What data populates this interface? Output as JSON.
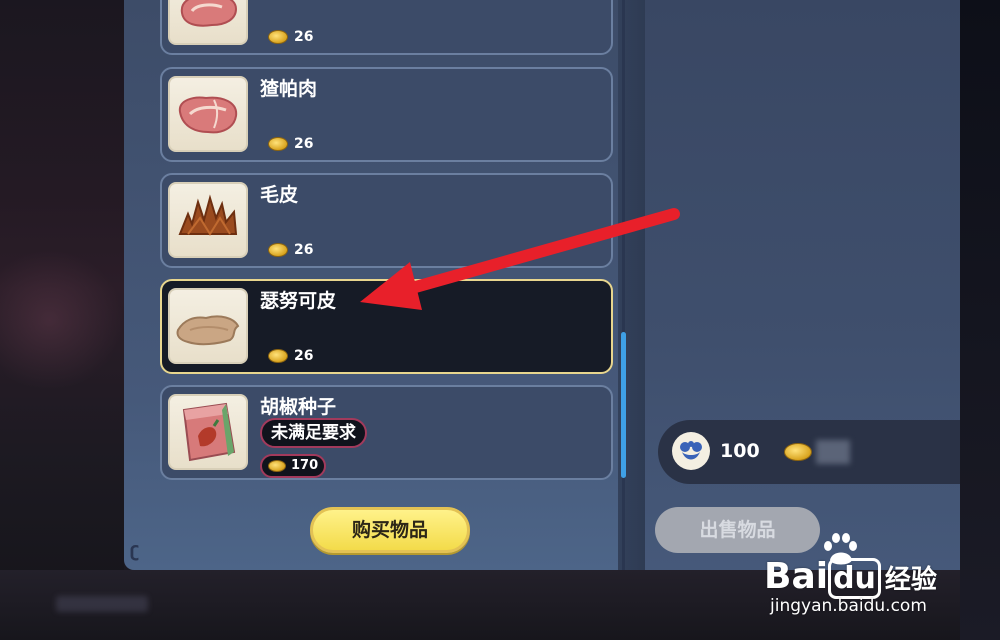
{
  "items": [
    {
      "name": "",
      "price": "26",
      "icon": "raw-meat-icon"
    },
    {
      "name": "猹帕肉",
      "price": "26",
      "icon": "raw-meat-icon"
    },
    {
      "name": "毛皮",
      "price": "26",
      "icon": "fur-icon"
    },
    {
      "name": "瑟努可皮",
      "price": "26",
      "icon": "hide-icon",
      "selected": true
    },
    {
      "name": "胡椒种子",
      "price": "170",
      "icon": "seed-packet-icon",
      "requirement": "未满足要求"
    }
  ],
  "buttons": {
    "buy": "购买物品",
    "sell": "出售物品"
  },
  "currency": {
    "points": "100",
    "points_icon": "blue-flower-icon",
    "coin_icon": "gold-coin-icon"
  },
  "watermark": {
    "logo": "Bai",
    "logo_du": "du",
    "logo_cn": "经验",
    "url": "jingyan.baidu.com"
  },
  "colors": {
    "panel": "#3d4c68",
    "selected_card": "#161b26",
    "selected_border": "#e8d68e",
    "buy_button": "#f3db4a",
    "sell_button_disabled": "#a3a7b0",
    "requirement_border": "#a23a5c",
    "scrollbar": "#3fa0e6",
    "annotation_arrow": "#e8202a"
  }
}
